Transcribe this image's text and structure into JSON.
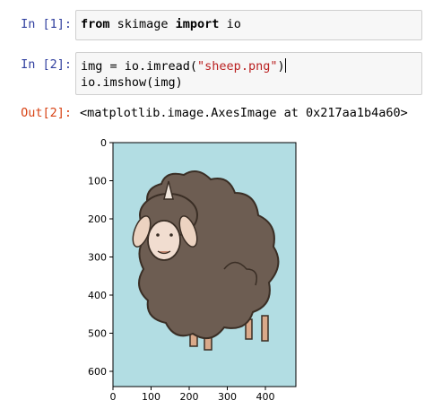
{
  "cells": {
    "cell1": {
      "prompt": "In [1]:",
      "code": {
        "kw1": "from",
        "mid": " skimage ",
        "kw2": "import",
        "rest": " io"
      }
    },
    "cell2": {
      "prompt": "In [2]:",
      "line1": {
        "pre": "img = io.imread(",
        "str": "\"sheep.png\"",
        "post": ")"
      },
      "line2": "io.imshow(img)"
    },
    "output2": {
      "prompt": "Out[2]:",
      "text": "<matplotlib.image.AxesImage at 0x217aa1b4a60>"
    }
  },
  "plot": {
    "image_description_name": "sheep.png",
    "background_color": "#b2dde3",
    "x_ticks": [
      "0",
      "100",
      "200",
      "300",
      "400"
    ],
    "y_ticks": [
      "0",
      "100",
      "200",
      "300",
      "400",
      "500",
      "600"
    ],
    "xlim": [
      0,
      480
    ],
    "ylim": [
      640,
      0
    ]
  }
}
